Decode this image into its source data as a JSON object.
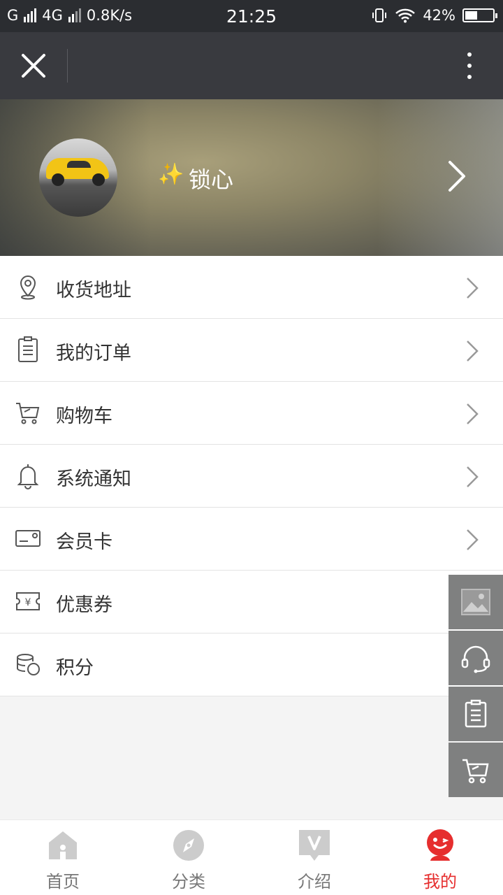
{
  "status_bar": {
    "carrier1": "G",
    "carrier2": "4G",
    "speed": "0.8K/s",
    "time": "21:25",
    "battery": "42%"
  },
  "nav": {
    "close_icon": "close-icon",
    "more_icon": "more-vertical-icon"
  },
  "profile": {
    "username": "锁心",
    "sparkle": "✨",
    "accent_color": "#f5b31d"
  },
  "menu": {
    "items": [
      {
        "label": "收货地址",
        "icon": "location-pin-icon"
      },
      {
        "label": "我的订单",
        "icon": "order-list-icon"
      },
      {
        "label": "购物车",
        "icon": "cart-icon"
      },
      {
        "label": "系统通知",
        "icon": "bell-icon"
      },
      {
        "label": "会员卡",
        "icon": "member-card-icon"
      },
      {
        "label": "优惠券",
        "icon": "coupon-icon"
      },
      {
        "label": "积分",
        "icon": "points-coins-icon"
      }
    ]
  },
  "float_actions": [
    "image-icon",
    "headset-icon",
    "clipboard-icon",
    "cart-icon"
  ],
  "tabs": [
    {
      "label": "首页",
      "icon": "home-icon",
      "active": false
    },
    {
      "label": "分类",
      "icon": "compass-icon",
      "active": false
    },
    {
      "label": "介绍",
      "icon": "intro-v-icon",
      "active": false
    },
    {
      "label": "我的",
      "icon": "mine-face-icon",
      "active": true
    }
  ],
  "colors": {
    "active_tab": "#e62e2e",
    "nav_bg": "#393a3f",
    "float_bg": "#7f8080"
  }
}
